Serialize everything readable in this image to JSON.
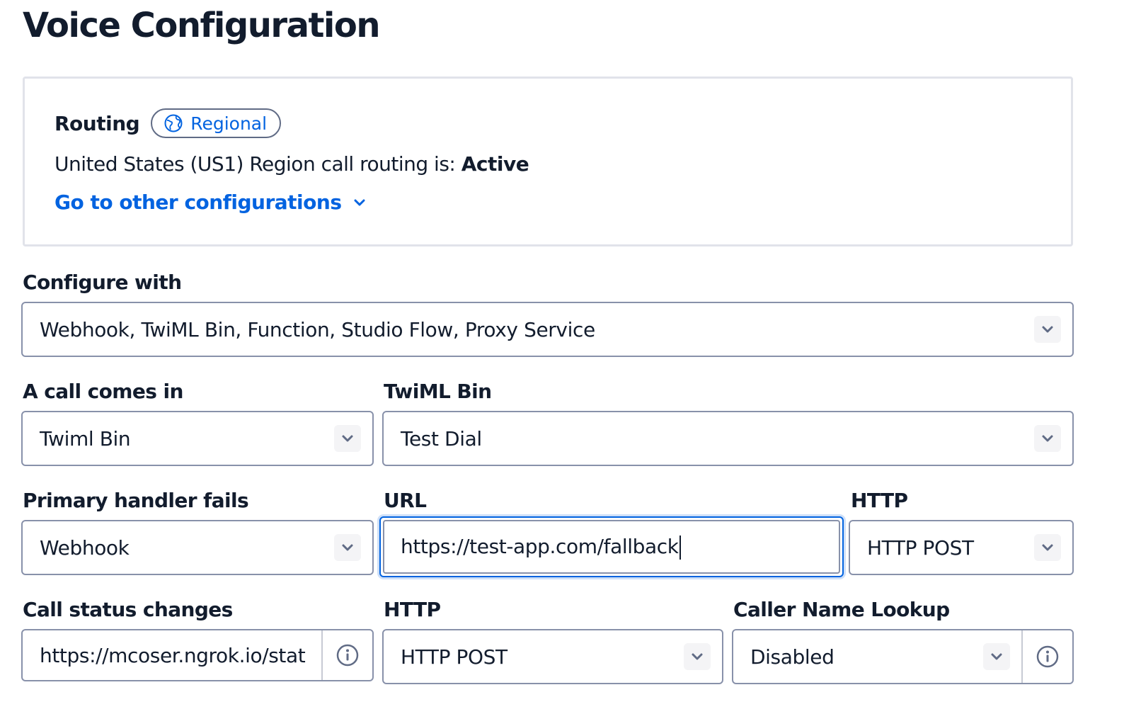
{
  "page": {
    "title": "Voice Configuration"
  },
  "routing": {
    "label": "Routing",
    "badge": "Regional",
    "status_prefix": "United States (US1) Region call routing is: ",
    "status_value": "Active",
    "link": "Go to other configurations"
  },
  "configure_with": {
    "label": "Configure with",
    "value": "Webhook, TwiML Bin, Function, Studio Flow, Proxy Service"
  },
  "call_comes_in": {
    "label": "A call comes in",
    "value": "Twiml Bin"
  },
  "twiml_bin": {
    "label": "TwiML Bin",
    "value": "Test Dial"
  },
  "primary_handler": {
    "label": "Primary handler fails",
    "value": "Webhook"
  },
  "url": {
    "label": "URL",
    "value": "https://test-app.com/fallback"
  },
  "http_fallback": {
    "label": "HTTP",
    "value": "HTTP POST"
  },
  "status_changes": {
    "label": "Call status changes",
    "value": "https://mcoser.ngrok.io/stat"
  },
  "http_status": {
    "label": "HTTP",
    "value": "HTTP POST"
  },
  "caller_name": {
    "label": "Caller Name Lookup",
    "value": "Disabled"
  },
  "colors": {
    "link": "#0263e0",
    "text": "#121c2d",
    "border": "#8891aa"
  }
}
